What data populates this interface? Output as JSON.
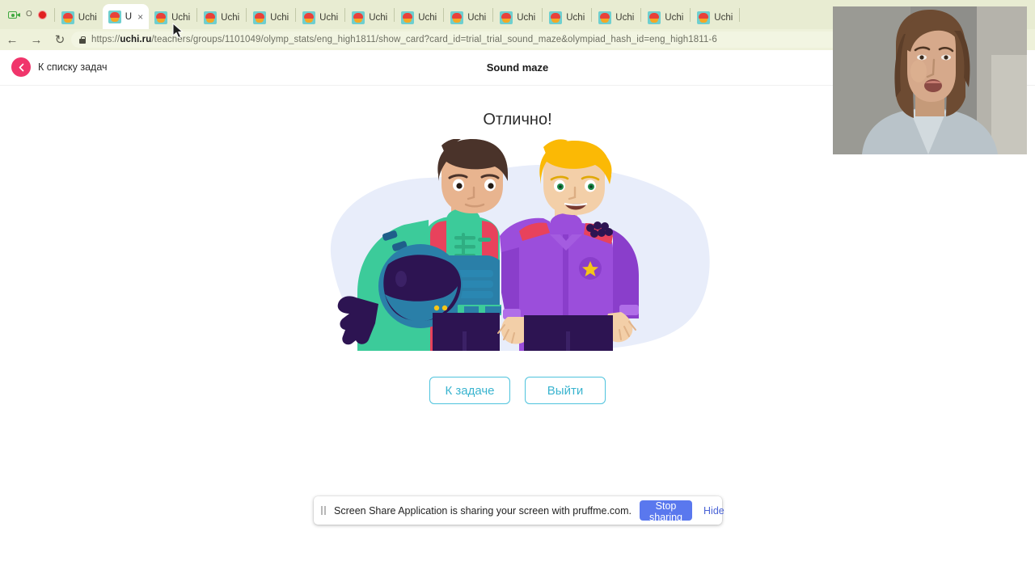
{
  "browser": {
    "controls": {
      "camera_icon": "camera-icon",
      "circle_mark": "O",
      "record_icon": "record-dot-icon"
    },
    "tabs": [
      {
        "label": "Uchi",
        "active": false
      },
      {
        "label": "U",
        "active": true
      },
      {
        "label": "Uchi",
        "active": false
      },
      {
        "label": "Uchi",
        "active": false
      },
      {
        "label": "Uchi",
        "active": false
      },
      {
        "label": "Uchi",
        "active": false
      },
      {
        "label": "Uchi",
        "active": false
      },
      {
        "label": "Uchi",
        "active": false
      },
      {
        "label": "Uchi",
        "active": false
      },
      {
        "label": "Uchi",
        "active": false
      },
      {
        "label": "Uchi",
        "active": false
      },
      {
        "label": "Uchi",
        "active": false
      },
      {
        "label": "Uchi",
        "active": false
      },
      {
        "label": "Uchi",
        "active": false
      }
    ],
    "nav": {
      "back": "←",
      "forward": "→",
      "reload": "↻"
    },
    "url_prefix": "https://",
    "url_domain": "uchi.ru",
    "url_path": "/teachers/groups/1101049/olymp_stats/eng_high1811/show_card?card_id=trial_trial_sound_maze&olympiad_hash_id=eng_high1811-6",
    "lock_icon": "lock-icon"
  },
  "page": {
    "back_link_label": "К списку задач",
    "title": "Sound maze",
    "headline": "Отлично!",
    "buttons": {
      "primary": "К задаче",
      "secondary": "Выйти"
    },
    "illustration": {
      "name": "two-students-celebrating-illustration",
      "blob_color": "#e8edfa",
      "left_character": {
        "hair_color": "#4a332a",
        "jacket_color": "#3ccb9a",
        "strap_color": "#e8425c",
        "helmet_color": "#2b1a52",
        "pants_color": "#2d1452"
      },
      "right_character": {
        "hair_color": "#fbb905",
        "jacket_color": "#9b4edb",
        "epaulette_color": "#e8425c",
        "star_color": "#f5c518",
        "pants_color": "#2d1452"
      }
    }
  },
  "share_notification": {
    "pause_icon": "pause-icon",
    "message": "Screen Share Application is sharing your screen with pruffme.com.",
    "stop_label": "Stop sharing",
    "hide_label": "Hide",
    "stop_color": "#5a78ee"
  },
  "webcam": {
    "name": "webcam-self-view",
    "background_color": "#8e8e8a",
    "shirt_color": "#b9c3c9",
    "hair_color": "#6d4b32",
    "skin_color": "#d6a98b"
  }
}
